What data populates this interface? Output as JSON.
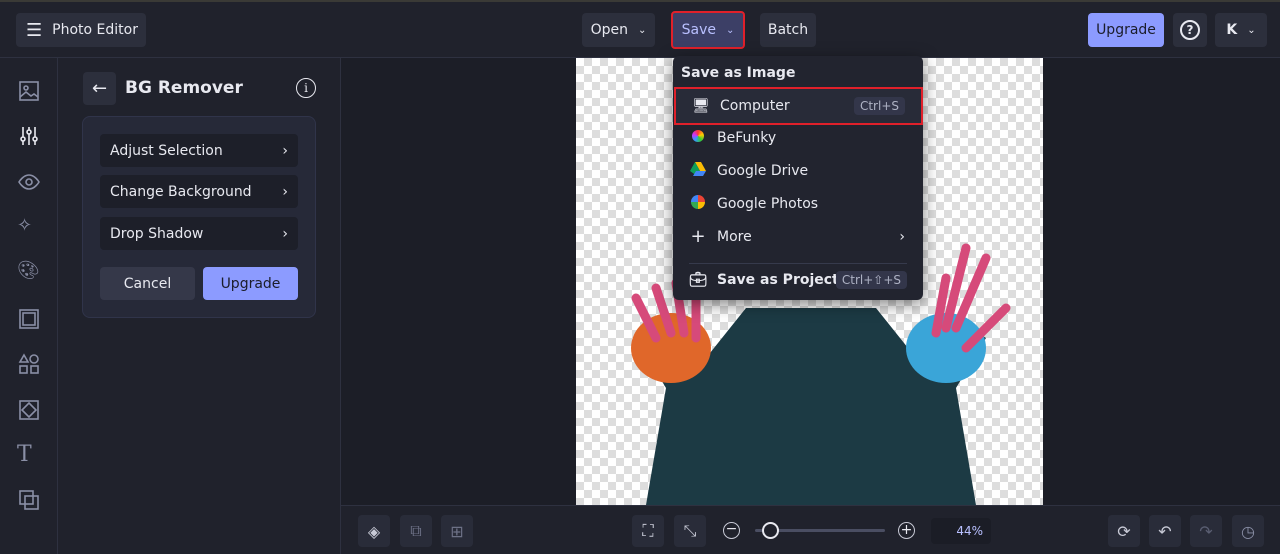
{
  "header": {
    "app_title": "Photo Editor",
    "open_label": "Open",
    "save_label": "Save",
    "batch_label": "Batch",
    "upgrade_label": "Upgrade",
    "help_icon": "question-icon",
    "avatar_initial": "K"
  },
  "rail": {
    "icons": [
      "image-icon",
      "sliders-icon",
      "eye-icon",
      "sparkles-icon",
      "palette-icon",
      "frame-icon",
      "shapes-icon",
      "texture-icon",
      "text-icon",
      "overlay-icon"
    ]
  },
  "panel": {
    "title": "BG Remover",
    "options": [
      {
        "label": "Adjust Selection"
      },
      {
        "label": "Change Background"
      },
      {
        "label": "Drop Shadow"
      }
    ],
    "cancel_label": "Cancel",
    "upgrade_label": "Upgrade"
  },
  "save_menu": {
    "heading": "Save as Image",
    "items": [
      {
        "label": "Computer",
        "shortcut": "Ctrl+S",
        "icon": "monitor-icon"
      },
      {
        "label": "BeFunky",
        "icon": "befunky-icon"
      },
      {
        "label": "Google Drive",
        "icon": "google-drive-icon"
      },
      {
        "label": "Google Photos",
        "icon": "google-photos-icon"
      },
      {
        "label": "More",
        "icon": "plus-icon"
      }
    ],
    "project": {
      "label": "Save as Project",
      "shortcut": "Ctrl+⇧+S",
      "icon": "briefcase-icon"
    }
  },
  "bottom": {
    "zoom_label": "44%",
    "zoom_percent": 44
  },
  "colors": {
    "accent": "#8c9bff",
    "highlight": "#e0202a"
  }
}
